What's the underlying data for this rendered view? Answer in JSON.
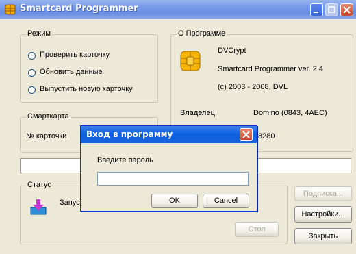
{
  "window": {
    "title": "Smartcard Programmer",
    "app_icon": "chip-icon"
  },
  "mode": {
    "label": "Режим",
    "options": [
      "Проверить карточку",
      "Обновить данные",
      "Выпустить новую карточку"
    ]
  },
  "about": {
    "label": "О Программе",
    "icon": "smartcard-chip-icon",
    "name": "DVCrypt",
    "version": "Smartcard Programmer ver. 2.4",
    "copyright": "(c) 2003 - 2008, DVL",
    "owner_label": "Владелец",
    "owner_value": "Domino (0843, 4AEC)",
    "partial_value": "8280"
  },
  "card": {
    "label": "Смарткарта",
    "number_label": "№ карточки"
  },
  "status": {
    "label": "Статус",
    "icon": "download-icon",
    "text": "Запус",
    "stop_label": "Стоп"
  },
  "actions": {
    "subscription": "Подписка...",
    "settings": "Настройки...",
    "close": "Закрыть"
  },
  "progress": {
    "percent": 0
  },
  "login_dialog": {
    "title": "Вход в программу",
    "prompt": "Введите пароль",
    "password_value": "",
    "ok": "OK",
    "cancel": "Cancel"
  },
  "colors": {
    "title_blue": "#0a5fe0",
    "window_face": "#ece9d8",
    "close_red": "#c9422a"
  }
}
